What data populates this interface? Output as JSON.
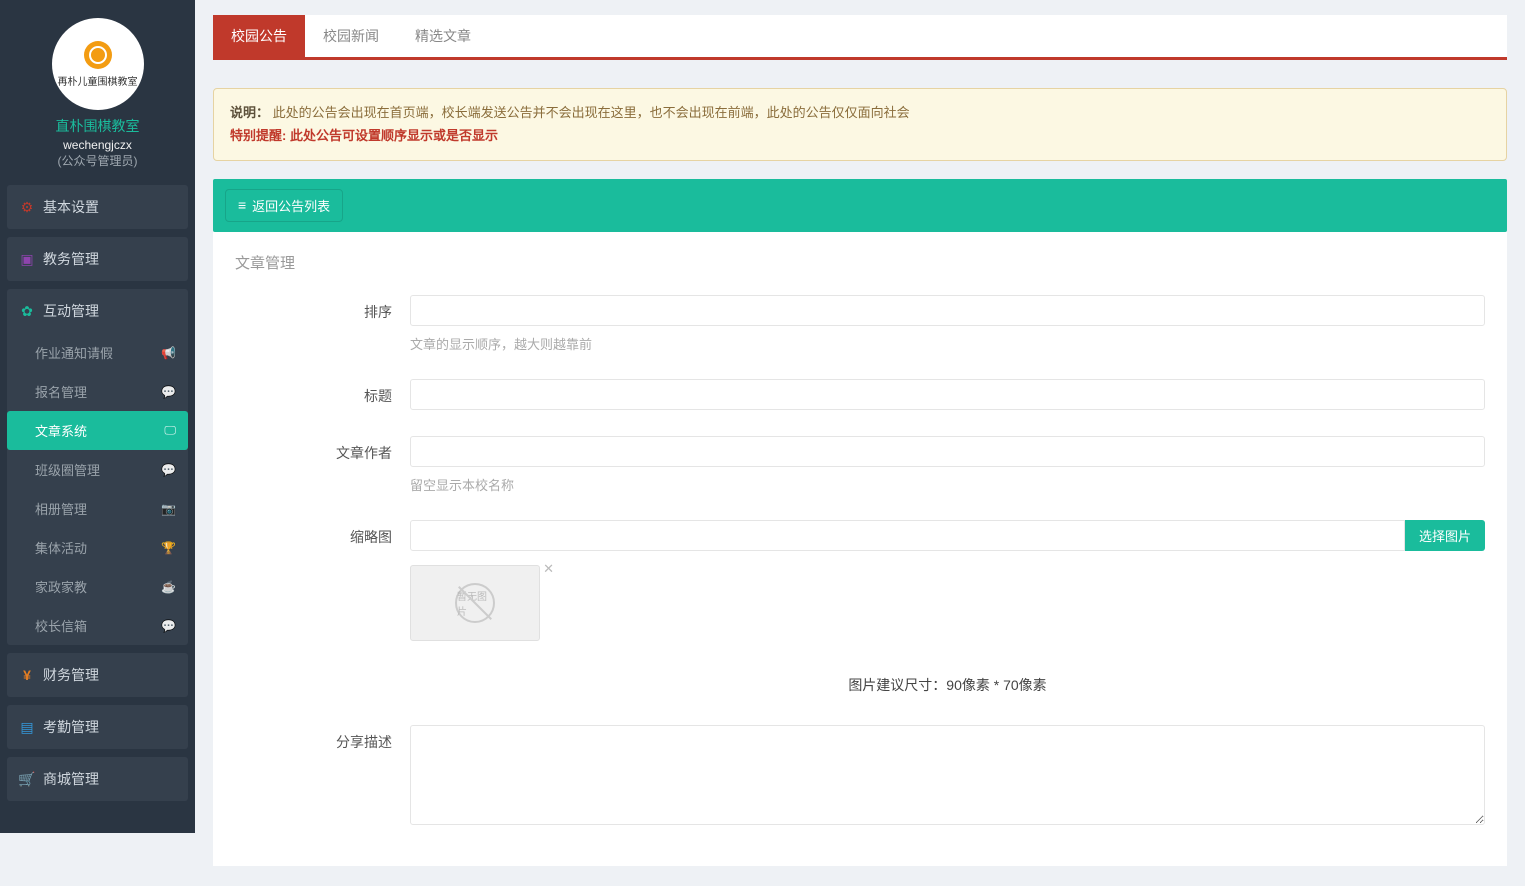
{
  "sidebar": {
    "logo_text": "再朴儿童围棋教室",
    "org_name": "直朴围棋教室",
    "account": "wechengjczx",
    "role": "(公众号管理员)",
    "sections": [
      {
        "label": "基本设置",
        "icon": "ic-gear"
      },
      {
        "label": "教务管理",
        "icon": "ic-book"
      },
      {
        "label": "互动管理",
        "icon": "ic-wechat",
        "items": [
          {
            "label": "作业通知请假"
          },
          {
            "label": "报名管理"
          },
          {
            "label": "文章系统",
            "active": true
          },
          {
            "label": "班级圈管理"
          },
          {
            "label": "相册管理"
          },
          {
            "label": "集体活动"
          },
          {
            "label": "家政家教"
          },
          {
            "label": "校长信箱"
          }
        ]
      },
      {
        "label": "财务管理",
        "icon": "ic-money"
      },
      {
        "label": "考勤管理",
        "icon": "ic-card"
      },
      {
        "label": "商城管理",
        "icon": "ic-cart"
      }
    ]
  },
  "tabs": {
    "items": [
      {
        "label": "校园公告",
        "active": true
      },
      {
        "label": "校园新闻"
      },
      {
        "label": "精选文章"
      }
    ]
  },
  "alert": {
    "label": "说明：",
    "text": "此处的公告会出现在首页端，校长端发送公告并不会出现在这里，也不会出现在前端，此处的公告仅仅面向社会",
    "tip_label": "特别提醒: ",
    "tip_text": "此处公告可设置顺序显示或是否显示"
  },
  "back_button": "返回公告列表",
  "panel_title": "文章管理",
  "form": {
    "sort": {
      "label": "排序",
      "value": "",
      "help": "文章的显示顺序，越大则越靠前"
    },
    "title": {
      "label": "标题",
      "value": ""
    },
    "author": {
      "label": "文章作者",
      "value": "",
      "help": "留空显示本校名称"
    },
    "thumb": {
      "label": "缩略图",
      "value": "",
      "choose": "选择图片",
      "placeholder_text": "暂无图片",
      "hint": "图片建议尺寸：90像素 * 70像素"
    },
    "share": {
      "label": "分享描述",
      "value": ""
    }
  }
}
